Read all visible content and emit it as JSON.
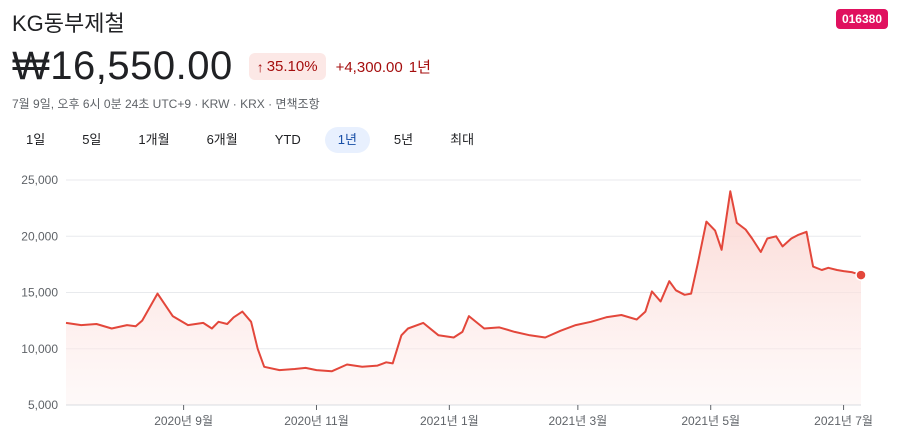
{
  "header": {
    "title": "KG동부제철",
    "ticker": "016380",
    "price": "₩16,550.00",
    "change_percent": "35.10%",
    "change_abs": "+4,300.00",
    "period": "1년",
    "meta": "7월 9일, 오후 6시 0분 24초 UTC+9 · KRW · KRX · 면책조항"
  },
  "tabs": [
    {
      "label": "1일"
    },
    {
      "label": "5일"
    },
    {
      "label": "1개월"
    },
    {
      "label": "6개월"
    },
    {
      "label": "YTD"
    },
    {
      "label": "1년",
      "active": true
    },
    {
      "label": "5년"
    },
    {
      "label": "최대"
    }
  ],
  "colors": {
    "line": "#e3473b",
    "fill": "#fbe2df",
    "accent_badge": "#e0115f",
    "negative_text": "#a50e0e"
  },
  "chart_data": {
    "type": "area",
    "ylim": [
      5000,
      25000
    ],
    "y_ticks": [
      5000,
      10000,
      15000,
      20000,
      25000
    ],
    "y_tick_labels": [
      "5,000",
      "10,000",
      "15,000",
      "20,000",
      "25,000"
    ],
    "x_ticks": [
      "2020-09-01",
      "2020-11-01",
      "2021-01-01",
      "2021-03-01",
      "2021-05-01",
      "2021-07-01"
    ],
    "x_tick_labels": [
      "2020년 9월",
      "2020년 11월",
      "2021년 1월",
      "2021년 3월",
      "2021년 5월",
      "2021년 7월"
    ],
    "grid": true,
    "series": [
      {
        "x": [
          "2020-07-09",
          "2020-07-16",
          "2020-07-23",
          "2020-07-30",
          "2020-08-06",
          "2020-08-10",
          "2020-08-13",
          "2020-08-20",
          "2020-08-27",
          "2020-09-03",
          "2020-09-10",
          "2020-09-14",
          "2020-09-17",
          "2020-09-21",
          "2020-09-24",
          "2020-09-28",
          "2020-10-02",
          "2020-10-05",
          "2020-10-08",
          "2020-10-15",
          "2020-10-22",
          "2020-10-27",
          "2020-11-01",
          "2020-11-08",
          "2020-11-15",
          "2020-11-22",
          "2020-11-29",
          "2020-12-03",
          "2020-12-06",
          "2020-12-10",
          "2020-12-13",
          "2020-12-20",
          "2020-12-27",
          "2021-01-03",
          "2021-01-07",
          "2021-01-10",
          "2021-01-17",
          "2021-01-24",
          "2021-01-31",
          "2021-02-07",
          "2021-02-14",
          "2021-02-21",
          "2021-02-28",
          "2021-03-07",
          "2021-03-14",
          "2021-03-21",
          "2021-03-28",
          "2021-04-01",
          "2021-04-04",
          "2021-04-08",
          "2021-04-12",
          "2021-04-15",
          "2021-04-19",
          "2021-04-22",
          "2021-04-25",
          "2021-04-29",
          "2021-05-03",
          "2021-05-06",
          "2021-05-10",
          "2021-05-13",
          "2021-05-17",
          "2021-05-20",
          "2021-05-24",
          "2021-05-27",
          "2021-05-31",
          "2021-06-03",
          "2021-06-07",
          "2021-06-10",
          "2021-06-14",
          "2021-06-17",
          "2021-06-21",
          "2021-06-24",
          "2021-06-28",
          "2021-07-01",
          "2021-07-05",
          "2021-07-09"
        ],
        "values": [
          12300,
          12100,
          12200,
          11800,
          12100,
          12000,
          12500,
          14900,
          12900,
          12100,
          12300,
          11800,
          12400,
          12200,
          12800,
          13300,
          12400,
          10000,
          8400,
          8100,
          8200,
          8300,
          8100,
          8000,
          8600,
          8400,
          8500,
          8800,
          8700,
          11200,
          11800,
          12300,
          11200,
          11000,
          11500,
          12900,
          11800,
          11900,
          11500,
          11200,
          11000,
          11600,
          12100,
          12400,
          12800,
          13000,
          12600,
          13300,
          15100,
          14200,
          16000,
          15200,
          14800,
          14900,
          17500,
          21300,
          20500,
          18800,
          24000,
          21200,
          20600,
          19800,
          18600,
          19800,
          20000,
          19100,
          19800,
          20100,
          20400,
          17300,
          17000,
          17200,
          17000,
          16900,
          16800,
          16550
        ]
      }
    ]
  }
}
